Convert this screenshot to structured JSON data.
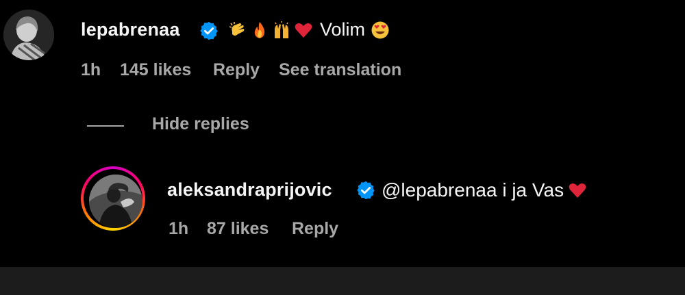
{
  "comment": {
    "username": "lepabrenaa",
    "text": "Volim",
    "emojis": [
      "clapping-hands",
      "fire",
      "raising-hands",
      "red-heart",
      "heart-eyes-face"
    ],
    "time": "1h",
    "likes": "145 likes",
    "reply_label": "Reply",
    "translate_label": "See translation"
  },
  "replies_toggle": {
    "label": "Hide replies"
  },
  "reply": {
    "username": "aleksandraprijovic",
    "text": "@lepabrenaa i ja Vas",
    "emojis": [
      "red-heart"
    ],
    "time": "1h",
    "likes": "87 likes",
    "reply_label": "Reply"
  },
  "colors": {
    "background": "#000000",
    "primary_text": "#f5f5f5",
    "secondary_text": "#a8a8a8",
    "verified_blue": "#0095f6",
    "heart_red": "#e0243a"
  }
}
